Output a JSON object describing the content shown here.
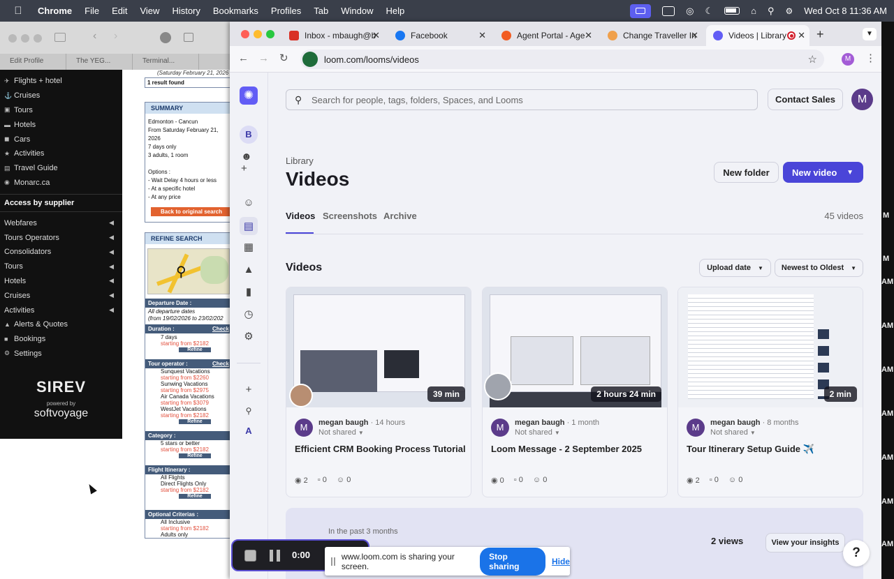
{
  "menubar": {
    "app": "Chrome",
    "items": [
      "File",
      "Edit",
      "View",
      "History",
      "Bookmarks",
      "Profiles",
      "Tab",
      "Window",
      "Help"
    ],
    "clock": "Wed Oct 8  11:36 AM"
  },
  "bg_window": {
    "tabs": [
      "Edit Profile",
      "The YEG...",
      "Terminal..."
    ],
    "sidebar_top": [
      {
        "label": "Flights + hotel",
        "icon": "flight-hotel-icon"
      },
      {
        "label": "Cruises",
        "icon": "ship-icon"
      },
      {
        "label": "Tours",
        "icon": "suitcase-icon"
      },
      {
        "label": "Hotels",
        "icon": "bed-icon"
      },
      {
        "label": "Cars",
        "icon": "car-icon"
      },
      {
        "label": "Activities",
        "icon": "activity-icon"
      },
      {
        "label": "Travel Guide",
        "icon": "book-icon"
      },
      {
        "label": "Monarc.ca",
        "icon": "globe-icon"
      }
    ],
    "supplier_header": "Access by supplier",
    "supplier_items": [
      "Webfares",
      "Tours Operators",
      "Consolidators",
      "Tours",
      "Hotels",
      "Cruises",
      "Activities"
    ],
    "sidebar_bottom": [
      {
        "label": "Alerts & Quotes",
        "icon": "bell-icon"
      },
      {
        "label": "Bookings",
        "icon": "briefcase-icon"
      },
      {
        "label": "Settings",
        "icon": "gear-icon"
      }
    ],
    "logo": "SIREV",
    "powered_by": "powered by",
    "softvoyage": "softvoyage",
    "search": {
      "date_line": "(Saturday February 21, 2026",
      "results": "1 result found",
      "summary_title": "SUMMARY",
      "summary_lines": [
        "Edmonton - Cancun",
        "From Saturday February 21,",
        "2026",
        "7 days only",
        "3 adults, 1 room"
      ],
      "options_title": "Options :",
      "options": [
        "- Wait Delay 4 hours or less",
        "- At a specific hotel",
        "- At any price"
      ],
      "back_button": "Back to original search",
      "refine_title": "REFINE SEARCH",
      "departure_title": "Departure Date :",
      "departure_lines": [
        "All departure dates",
        "(from 19/02/2026 to 23/02/202"
      ],
      "duration_title": "Duration :",
      "check": "Check",
      "duration_option": "7 days",
      "duration_price": "starting from $2182",
      "refine_label": "Refine",
      "operator_title": "Tour operator :",
      "operators": [
        {
          "name": "Sunquest Vacations",
          "price": "starting from $2260"
        },
        {
          "name": "Sunwing Vacations",
          "price": "starting from $2975"
        },
        {
          "name": "Air Canada Vacations",
          "price": "starting from $3079"
        },
        {
          "name": "WestJet Vacations",
          "price": "starting from $2182"
        }
      ],
      "category_title": "Category :",
      "category_option": "5 stars or better",
      "category_price": "starting from $2182",
      "flight_title": "Flight Itinerary :",
      "flight_options": [
        "All Flights",
        "Direct Flights Only"
      ],
      "flight_price": "starting from $2182",
      "optional_title": "Optional Criterias :",
      "optional_option": "All Inclusive",
      "optional_price": "starting from $2182",
      "optional_option2": "Adults only"
    }
  },
  "tabs": [
    {
      "title": "Inbox - mbaugh@b",
      "icon": "gmail-icon",
      "color": "#d93025"
    },
    {
      "title": "Facebook",
      "icon": "facebook-icon",
      "color": "#1877f2"
    },
    {
      "title": "Agent Portal - Age",
      "icon": "agent-portal-icon",
      "color": "#f25c22"
    },
    {
      "title": "Change Traveller In",
      "icon": "traveller-icon",
      "color": "#f0a04b"
    },
    {
      "title": "Videos | Library",
      "icon": "loom-icon",
      "color": "#625df5"
    }
  ],
  "url": "loom.com/looms/videos",
  "profile_initial": "M",
  "loom": {
    "rail_top_letter": "B",
    "rail_bottom_letter": "A",
    "search_placeholder": "Search for people, tags, folders, Spaces, and Looms",
    "contact_sales": "Contact Sales",
    "avatar_initial": "M",
    "library_label": "Library",
    "page_title": "Videos",
    "new_folder": "New folder",
    "new_video": "New video",
    "subtabs": [
      "Videos",
      "Screenshots",
      "Archive"
    ],
    "video_count": "45 videos",
    "section_title": "Videos",
    "sort_filter": "Upload date",
    "sort_order": "Newest to Oldest",
    "videos": [
      {
        "author": "megan baugh",
        "age": "14 hours",
        "sharing": "Not shared",
        "title": "Efficient CRM Booking Process Tutorial",
        "duration": "39 min",
        "views": "2",
        "comments": "0",
        "reactions": "0"
      },
      {
        "author": "megan baugh",
        "age": "1 month",
        "sharing": "Not shared",
        "title": "Loom Message - 2 September 2025",
        "duration": "2 hours 24 min",
        "views": "0",
        "comments": "0",
        "reactions": "0"
      },
      {
        "author": "megan baugh",
        "age": "8 months",
        "sharing": "Not shared",
        "title": "Tour Itinerary Setup Guide ✈️",
        "duration": "2 min",
        "views": "2",
        "comments": "0",
        "reactions": "0"
      }
    ],
    "insights_sub": "In the past 3 months",
    "insights_views": "2 views",
    "insights_button": "View your insights",
    "help": "?",
    "accent": "#625df5"
  },
  "recorder": {
    "time": "0:00"
  },
  "share_bar": {
    "text": "www.loom.com is sharing your screen.",
    "stop": "Stop sharing",
    "hide": "Hide"
  },
  "edge_letters": [
    "M",
    "M",
    "AM",
    "AM",
    "AM",
    "AM",
    "AM",
    "AM",
    "AM"
  ]
}
